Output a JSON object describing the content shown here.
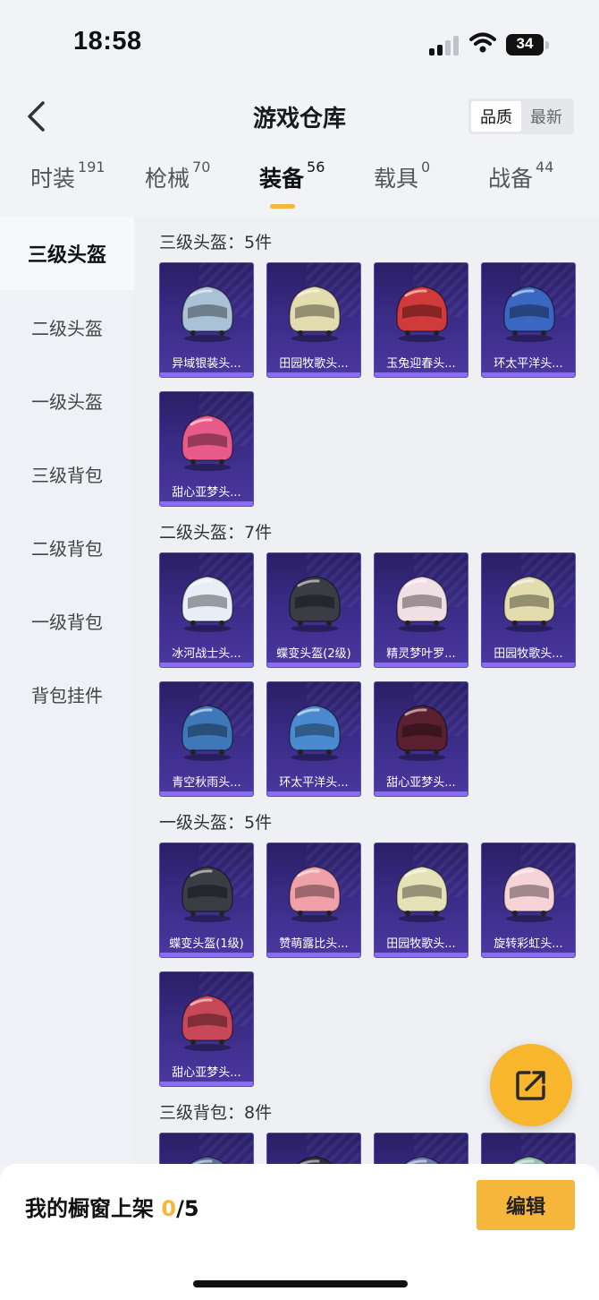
{
  "status": {
    "time": "18:58",
    "battery": "34"
  },
  "header": {
    "title": "游戏仓库",
    "back_icon": "chevron-left-icon",
    "sort_options": [
      "品质",
      "最新"
    ],
    "sort_active": "品质"
  },
  "tabs": [
    {
      "label": "时装",
      "count": "191"
    },
    {
      "label": "枪械",
      "count": "70"
    },
    {
      "label": "装备",
      "count": "56"
    },
    {
      "label": "载具",
      "count": "0"
    },
    {
      "label": "战备",
      "count": "44"
    }
  ],
  "sidebar": {
    "items": [
      {
        "label": "三级头盔"
      },
      {
        "label": "二级头盔"
      },
      {
        "label": "一级头盔"
      },
      {
        "label": "三级背包"
      },
      {
        "label": "二级背包"
      },
      {
        "label": "一级背包"
      },
      {
        "label": "背包挂件"
      }
    ]
  },
  "sections": [
    {
      "title": "三级头盔：5件",
      "items": [
        {
          "name": "异域银装头...",
          "color": "#a9c2d6"
        },
        {
          "name": "田园牧歌头...",
          "color": "#e3dcae"
        },
        {
          "name": "玉兔迎春头...",
          "color": "#d03a3a"
        },
        {
          "name": "环太平洋头...",
          "color": "#3a67c2"
        },
        {
          "name": "甜心亚梦头...",
          "color": "#e85a8a"
        }
      ]
    },
    {
      "title": "二级头盔：7件",
      "items": [
        {
          "name": "冰河战士头...",
          "color": "#e8eef5"
        },
        {
          "name": "蝶变头盔(2级)",
          "color": "#3a3d44"
        },
        {
          "name": "精灵梦叶罗...",
          "color": "#f1dfe6"
        },
        {
          "name": "田园牧歌头...",
          "color": "#e3dcae"
        },
        {
          "name": "青空秋雨头...",
          "color": "#3f78b8"
        },
        {
          "name": "环太平洋头...",
          "color": "#4a8ad0"
        },
        {
          "name": "甜心亚梦头...",
          "color": "#5a2030"
        }
      ]
    },
    {
      "title": "一级头盔：5件",
      "items": [
        {
          "name": "蝶变头盔(1级)",
          "color": "#3a3d44"
        },
        {
          "name": "赞萌露比头...",
          "color": "#f0a0a8"
        },
        {
          "name": "田园牧歌头...",
          "color": "#e6e2b8"
        },
        {
          "name": "旋转彩虹头...",
          "color": "#f6d3d7"
        },
        {
          "name": "甜心亚梦头...",
          "color": "#c84858"
        }
      ]
    },
    {
      "title": "三级背包：8件",
      "items": [
        {
          "name": "",
          "color": "#5a6a9a"
        },
        {
          "name": "",
          "color": "#2e2e3a"
        },
        {
          "name": "",
          "color": "#6a78b0"
        },
        {
          "name": "",
          "color": "#98c0b0"
        }
      ]
    }
  ],
  "bottom": {
    "label": "我的橱窗上架",
    "count": "0",
    "total": "/5",
    "edit": "编辑"
  },
  "fab": {
    "icon": "share-icon"
  },
  "colors": {
    "accent": "#f6b63b",
    "card_bg": "#3a2b86"
  }
}
